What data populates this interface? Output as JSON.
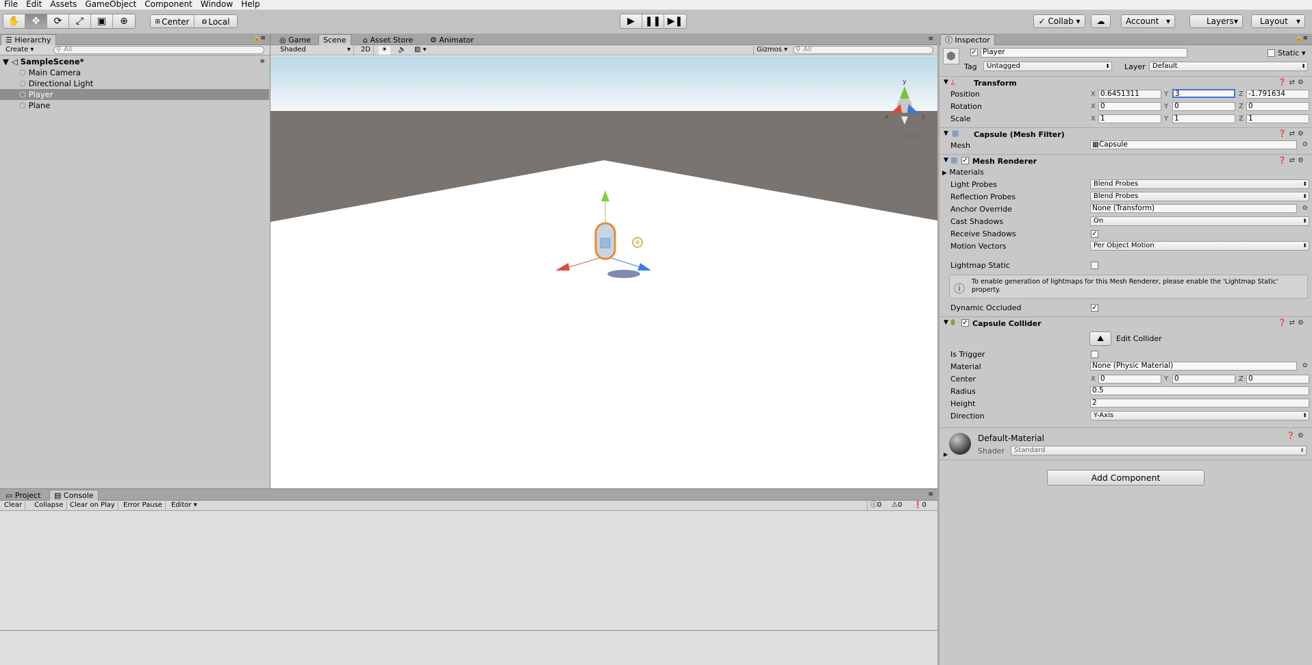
{
  "menu": [
    "File",
    "Edit",
    "Assets",
    "GameObject",
    "Component",
    "Window",
    "Help"
  ],
  "toolbar": {
    "pivot": "Center",
    "space": "Local",
    "collab": "Collab",
    "account": "Account",
    "layers": "Layers",
    "layout": "Layout"
  },
  "hierarchy": {
    "tab": "Hierarchy",
    "create": "Create",
    "search_placeholder": "All",
    "scene": "SampleScene*",
    "items": [
      "Main Camera",
      "Directional Light",
      "Player",
      "Plane"
    ]
  },
  "scene_view": {
    "tabs": [
      "Game",
      "Scene",
      "Asset Store",
      "Animator"
    ],
    "shading": "Shaded",
    "mode2d": "2D",
    "gizmos": "Gizmos",
    "search_placeholder": "All",
    "persp": "Persp",
    "axis_y": "y",
    "axis_x": "x",
    "axis_z": "z"
  },
  "console": {
    "tabs": [
      "Project",
      "Console"
    ],
    "buttons": [
      "Clear",
      "Collapse",
      "Clear on Play",
      "Error Pause",
      "Editor"
    ],
    "counts": {
      "info": "0",
      "warn": "0",
      "error": "0"
    }
  },
  "inspector": {
    "tab": "Inspector",
    "name": "Player",
    "static": "Static",
    "tag_label": "Tag",
    "tag": "Untagged",
    "layer_label": "Layer",
    "layer": "Default",
    "transform": {
      "title": "Transform",
      "position_label": "Position",
      "rotation_label": "Rotation",
      "scale_label": "Scale",
      "position": [
        "0.6451311",
        "3",
        "-1.791634"
      ],
      "rotation": [
        "0",
        "0",
        "0"
      ],
      "scale": [
        "1",
        "1",
        "1"
      ]
    },
    "mesh_filter": {
      "title": "Capsule (Mesh Filter)",
      "mesh_label": "Mesh",
      "mesh": "Capsule"
    },
    "mesh_renderer": {
      "title": "Mesh Renderer",
      "materials": "Materials",
      "light_probes_label": "Light Probes",
      "light_probes": "Blend Probes",
      "reflection_probes_label": "Reflection Probes",
      "reflection_probes": "Blend Probes",
      "anchor_override_label": "Anchor Override",
      "anchor_override": "None (Transform)",
      "cast_shadows_label": "Cast Shadows",
      "cast_shadows": "On",
      "receive_shadows_label": "Receive Shadows",
      "motion_vectors_label": "Motion Vectors",
      "motion_vectors": "Per Object Motion",
      "lightmap_static_label": "Lightmap Static",
      "info": "To enable generation of lightmaps for this Mesh Renderer, please enable the 'Lightmap Static' property.",
      "dynamic_occluded_label": "Dynamic Occluded"
    },
    "capsule_collider": {
      "title": "Capsule Collider",
      "edit_collider": "Edit Collider",
      "is_trigger_label": "Is Trigger",
      "material_label": "Material",
      "material": "None (Physic Material)",
      "center_label": "Center",
      "center": [
        "0",
        "0",
        "0"
      ],
      "radius_label": "Radius",
      "radius": "0.5",
      "height_label": "Height",
      "height": "2",
      "direction_label": "Direction",
      "direction": "Y-Axis"
    },
    "material": {
      "name": "Default-Material",
      "shader_label": "Shader",
      "shader": "Standard"
    },
    "add_component": "Add Component",
    "axis_labels": [
      "X",
      "Y",
      "Z"
    ]
  }
}
